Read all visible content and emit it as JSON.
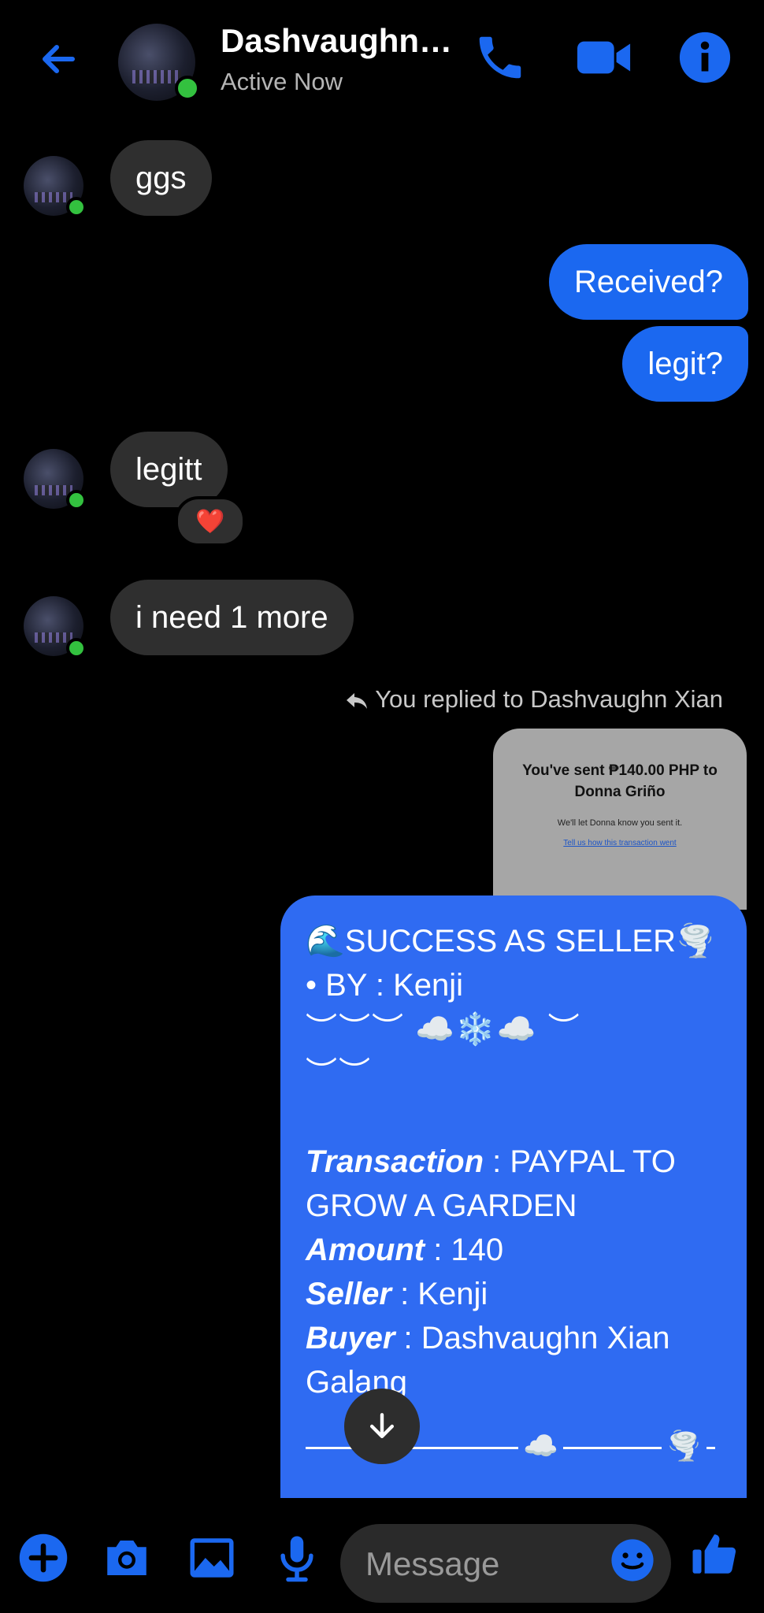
{
  "header": {
    "name": "Dashvaughn…",
    "status": "Active Now",
    "accent": "#1b68f0"
  },
  "messages": {
    "m1": "ggs",
    "m2": "Received?",
    "m3": "legit?",
    "m4": "legitt",
    "m4_reaction": "❤️",
    "m5": "i need 1 more",
    "reply_note": "You replied to Dashvaughn Xian"
  },
  "quoted": {
    "title": "You've sent ₱140.00 PHP to Donna Griño",
    "subtitle": "We'll let Donna know you sent it.",
    "link": "Tell us how this transaction went"
  },
  "big_message": {
    "line1": "🌊SUCCESS AS SELLER🌪️",
    "line2": "• BY : Kenji",
    "line3": "︶︶︶ ☁️❄️☁️ ︶",
    "line4": "︶︶",
    "transaction_label": "Transaction",
    "transaction_value": " : PAYPAL TO GROW A GARDEN",
    "amount_label": "Amount",
    "amount_value": " : 140",
    "seller_label": "Seller",
    "seller_value": " : Kenji",
    "buyer_label": "Buyer",
    "buyer_value": " : Dashvaughn Xian Galang",
    "divider_cloud": "☁️",
    "divider_tornado": "🌪️"
  },
  "composer": {
    "placeholder": "Message"
  },
  "icons": {
    "back": "arrow-left",
    "call": "phone",
    "video": "video-camera",
    "info": "info",
    "plus": "plus",
    "camera": "camera",
    "gallery": "image",
    "mic": "microphone",
    "emoji": "smile",
    "like": "thumbs-up",
    "scroll": "arrow-down"
  }
}
